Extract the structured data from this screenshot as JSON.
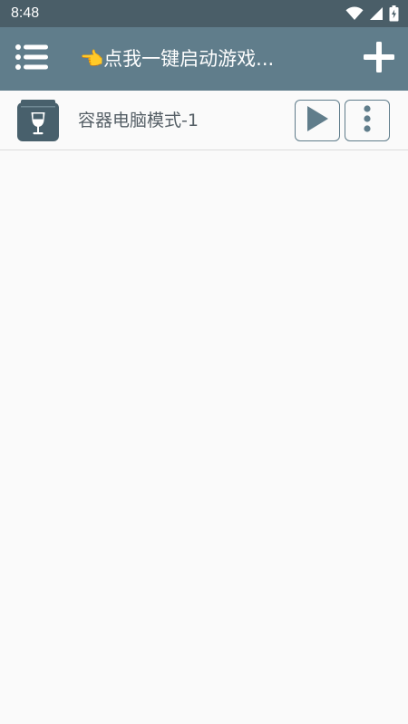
{
  "status_bar": {
    "time": "8:48",
    "icons": [
      "wifi-icon",
      "signal-icon",
      "battery-charging-icon"
    ]
  },
  "app_bar": {
    "menu_icon": "menu-list-icon",
    "title": "👈点我一键启动游戏...",
    "add_icon": "plus-icon"
  },
  "containers": [
    {
      "icon": "wine-glass-box-icon",
      "name": "容器电脑模式-1",
      "play_icon": "play-icon",
      "more_icon": "more-vertical-icon"
    }
  ],
  "colors": {
    "status_bar": "#4a5e68",
    "app_bar": "#607d8b",
    "accent": "#607d8b",
    "background": "#fafafa"
  }
}
